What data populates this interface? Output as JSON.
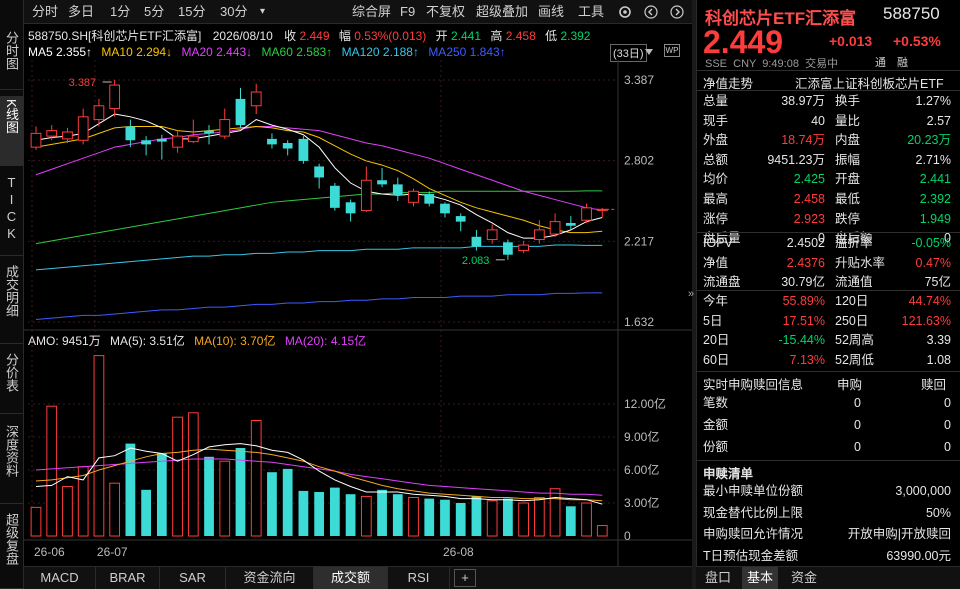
{
  "left_tabs": [
    {
      "label": "分时图",
      "name": "vtab-fenshi"
    },
    {
      "label": "K线图",
      "name": "vtab-kline"
    },
    {
      "label": "TICK",
      "name": "vtab-tick"
    },
    {
      "label": "成交明细",
      "name": "vtab-chengjiao"
    },
    {
      "label": "分价表",
      "name": "vtab-fenjia"
    },
    {
      "label": "深度资料",
      "name": "vtab-shendu"
    },
    {
      "label": "超级复盘",
      "name": "vtab-fupan"
    }
  ],
  "toolbar": {
    "fenshi": "分时",
    "duori": "多日",
    "m1": "1分",
    "m5": "5分",
    "m15": "15分",
    "m30": "30分",
    "more": "▾",
    "zonghe": "综合屏",
    "f9": "F9",
    "bufuquan": "不复权",
    "chaoji": "超级叠加",
    "huaxian": "画线",
    "gongju": "工具"
  },
  "info": {
    "code_name": "588750.SH[科创芯片ETF汇添富]",
    "date": "2026/08/10",
    "close_label": "收",
    "close": "2.449",
    "change_label": "幅",
    "change": "0.53%(0.013)",
    "open_label": "开",
    "open": "2.441",
    "high_label": "高",
    "high": "2.458",
    "low_label": "低",
    "low": "2.392",
    "ma5": "MA5 2.355↑",
    "ma10": "MA10 2.294↓",
    "ma20": "MA20 2.443↓",
    "ma60": "MA60 2.583↑",
    "ma120": "MA120 2.188↑",
    "ma250": "MA250 1.843↑",
    "period_count": "(33日)"
  },
  "price_axis": [
    "3.387",
    "2.802",
    "2.217",
    "1.632"
  ],
  "annotations": {
    "high": "3.387",
    "low": "2.083"
  },
  "volume_info": {
    "amo": "AMO: 9451万",
    "ma5": "MA(5): 3.51亿",
    "ma10": "MA(10): 3.70亿",
    "ma20": "MA(20): 4.15亿"
  },
  "volume_axis": [
    "12.00亿",
    "9.00亿",
    "6.00亿",
    "3.00亿",
    "0"
  ],
  "date_axis": [
    "26-06",
    "26-07",
    "26-08"
  ],
  "bottom_tabs": [
    "MACD",
    "BRAR",
    "SAR",
    "资金流向",
    "成交额",
    "RSI",
    "+"
  ],
  "colors": {
    "up": "#ff3c3c",
    "down": "#00d36a",
    "cyan": "#3ddbd6",
    "ma5": "#ffffff",
    "ma10": "#f5c400",
    "ma20": "#e040fb",
    "ma60": "#2ecc40",
    "ma120": "#37c6e6",
    "ma250": "#3d5cff"
  },
  "chart_data": {
    "type": "candlestick",
    "candles": [
      {
        "o": 2.9,
        "c": 3.0,
        "h": 3.05,
        "l": 2.88
      },
      {
        "o": 2.98,
        "c": 3.02,
        "h": 3.06,
        "l": 2.95
      },
      {
        "o": 2.96,
        "c": 3.01,
        "h": 3.04,
        "l": 2.93
      },
      {
        "o": 2.95,
        "c": 3.12,
        "h": 3.18,
        "l": 2.92
      },
      {
        "o": 3.1,
        "c": 3.2,
        "h": 3.25,
        "l": 3.05
      },
      {
        "o": 3.18,
        "c": 3.35,
        "h": 3.387,
        "l": 3.12
      },
      {
        "o": 3.05,
        "c": 2.95,
        "h": 3.1,
        "l": 2.9
      },
      {
        "o": 2.95,
        "c": 2.92,
        "h": 2.98,
        "l": 2.84
      },
      {
        "o": 2.96,
        "c": 2.94,
        "h": 2.99,
        "l": 2.81
      },
      {
        "o": 2.9,
        "c": 2.98,
        "h": 3.02,
        "l": 2.86
      },
      {
        "o": 2.94,
        "c": 2.98,
        "h": 3.1,
        "l": 2.93
      },
      {
        "o": 3.02,
        "c": 3.0,
        "h": 3.06,
        "l": 2.92
      },
      {
        "o": 2.98,
        "c": 3.1,
        "h": 3.18,
        "l": 2.96
      },
      {
        "o": 3.25,
        "c": 3.06,
        "h": 3.33,
        "l": 3.04
      },
      {
        "o": 3.2,
        "c": 3.3,
        "h": 3.36,
        "l": 3.14
      },
      {
        "o": 2.96,
        "c": 2.92,
        "h": 3.0,
        "l": 2.89
      },
      {
        "o": 2.93,
        "c": 2.89,
        "h": 2.95,
        "l": 2.84
      },
      {
        "o": 2.96,
        "c": 2.8,
        "h": 2.98,
        "l": 2.78
      },
      {
        "o": 2.76,
        "c": 2.68,
        "h": 2.78,
        "l": 2.6
      },
      {
        "o": 2.62,
        "c": 2.46,
        "h": 2.64,
        "l": 2.44
      },
      {
        "o": 2.5,
        "c": 2.42,
        "h": 2.52,
        "l": 2.36
      },
      {
        "o": 2.44,
        "c": 2.66,
        "h": 2.76,
        "l": 2.43
      },
      {
        "o": 2.66,
        "c": 2.63,
        "h": 2.75,
        "l": 2.61
      },
      {
        "o": 2.63,
        "c": 2.55,
        "h": 2.68,
        "l": 2.51
      },
      {
        "o": 2.5,
        "c": 2.58,
        "h": 2.6,
        "l": 2.47
      },
      {
        "o": 2.56,
        "c": 2.49,
        "h": 2.58,
        "l": 2.47
      },
      {
        "o": 2.49,
        "c": 2.42,
        "h": 2.5,
        "l": 2.39
      },
      {
        "o": 2.4,
        "c": 2.36,
        "h": 2.42,
        "l": 2.29
      },
      {
        "o": 2.25,
        "c": 2.18,
        "h": 2.3,
        "l": 2.15
      },
      {
        "o": 2.23,
        "c": 2.3,
        "h": 2.34,
        "l": 2.2
      },
      {
        "o": 2.21,
        "c": 2.12,
        "h": 2.23,
        "l": 2.083
      },
      {
        "o": 2.15,
        "c": 2.19,
        "h": 2.22,
        "l": 2.13
      },
      {
        "o": 2.23,
        "c": 2.3,
        "h": 2.37,
        "l": 2.2
      },
      {
        "o": 2.27,
        "c": 2.36,
        "h": 2.42,
        "l": 2.25
      },
      {
        "o": 2.35,
        "c": 2.33,
        "h": 2.4,
        "l": 2.3
      },
      {
        "o": 2.37,
        "c": 2.46,
        "h": 2.49,
        "l": 2.35
      },
      {
        "o": 2.441,
        "c": 2.449,
        "h": 2.458,
        "l": 2.392
      }
    ],
    "volumes": [
      2.6,
      11.8,
      4.5,
      6.3,
      16.4,
      4.8,
      8.4,
      4.2,
      7.5,
      10.8,
      11.2,
      7.2,
      6.8,
      8.0,
      10.5,
      5.8,
      6.1,
      4.1,
      4.0,
      4.4,
      3.8,
      3.6,
      4.2,
      3.8,
      3.5,
      3.4,
      3.3,
      3.0,
      3.6,
      3.2,
      3.4,
      3.0,
      3.5,
      4.3,
      2.7,
      3.0,
      0.95
    ],
    "vol_ma5": [
      4.5,
      4.6,
      5.4,
      5.1,
      7.1,
      7.3,
      8.0,
      7.7,
      7.5,
      6.8,
      7.4,
      8.1,
      8.3,
      8.4,
      8.2,
      7.8,
      7.6,
      6.9,
      5.9,
      5.1,
      4.5,
      4.0,
      4.0,
      4.0,
      3.8,
      3.7,
      3.6,
      3.4,
      3.4,
      3.3,
      3.3,
      3.2,
      3.3,
      3.5,
      3.4,
      3.3,
      2.9
    ],
    "vol_ma10": [
      5.0,
      5.1,
      5.3,
      5.5,
      6.0,
      6.4,
      6.8,
      7.2,
      7.5,
      7.6,
      7.8,
      7.9,
      7.8,
      7.7,
      7.6,
      7.4,
      7.1,
      6.8,
      6.3,
      5.9,
      5.4,
      5.0,
      4.6,
      4.3,
      4.1,
      3.9,
      3.8,
      3.7,
      3.6,
      3.5,
      3.5,
      3.4,
      3.4,
      3.4,
      3.3,
      3.3,
      3.2
    ],
    "vol_ma20": [
      6.0,
      6.1,
      6.2,
      6.3,
      6.4,
      6.5,
      6.6,
      6.7,
      6.8,
      6.9,
      7.0,
      7.0,
      7.0,
      6.9,
      6.8,
      6.7,
      6.5,
      6.3,
      6.1,
      5.9,
      5.6,
      5.4,
      5.2,
      5.0,
      4.8,
      4.6,
      4.5,
      4.4,
      4.3,
      4.2,
      4.1,
      4.0,
      3.9,
      3.9,
      3.8,
      3.8,
      3.7
    ],
    "ma5": [
      2.95,
      2.97,
      2.98,
      3.0,
      3.07,
      3.14,
      3.12,
      3.09,
      3.04,
      2.96,
      2.96,
      2.98,
      3.0,
      3.02,
      3.1,
      3.06,
      3.03,
      2.99,
      2.9,
      2.75,
      2.64,
      2.58,
      2.56,
      2.55,
      2.56,
      2.55,
      2.52,
      2.48,
      2.41,
      2.35,
      2.28,
      2.24,
      2.24,
      2.26,
      2.3,
      2.36,
      2.39
    ],
    "ma10": [
      2.9,
      2.92,
      2.94,
      2.96,
      3.0,
      3.04,
      3.05,
      3.05,
      3.05,
      3.02,
      3.01,
      3.02,
      3.03,
      3.04,
      3.05,
      3.04,
      3.02,
      3.01,
      2.97,
      2.91,
      2.85,
      2.8,
      2.77,
      2.73,
      2.67,
      2.6,
      2.55,
      2.5,
      2.46,
      2.43,
      2.4,
      2.37,
      2.33,
      2.3,
      2.28,
      2.28,
      2.29
    ],
    "ma20": [
      2.7,
      2.74,
      2.78,
      2.82,
      2.86,
      2.9,
      2.92,
      2.94,
      2.96,
      2.97,
      2.99,
      3.0,
      3.01,
      3.03,
      3.05,
      3.05,
      3.04,
      3.03,
      3.02,
      2.99,
      2.96,
      2.93,
      2.91,
      2.88,
      2.85,
      2.82,
      2.78,
      2.74,
      2.7,
      2.66,
      2.62,
      2.58,
      2.55,
      2.52,
      2.49,
      2.46,
      2.443
    ],
    "ma60": [
      2.2,
      2.22,
      2.24,
      2.26,
      2.28,
      2.3,
      2.32,
      2.34,
      2.36,
      2.38,
      2.4,
      2.42,
      2.44,
      2.46,
      2.48,
      2.5,
      2.51,
      2.52,
      2.53,
      2.54,
      2.55,
      2.56,
      2.56,
      2.57,
      2.57,
      2.57,
      2.58,
      2.58,
      2.58,
      2.58,
      2.58,
      2.58,
      2.58,
      2.58,
      2.58,
      2.583,
      2.583
    ],
    "ma120": [
      2.01,
      2.02,
      2.03,
      2.04,
      2.05,
      2.06,
      2.07,
      2.08,
      2.09,
      2.1,
      2.11,
      2.11,
      2.12,
      2.12,
      2.13,
      2.13,
      2.14,
      2.14,
      2.15,
      2.15,
      2.15,
      2.16,
      2.16,
      2.16,
      2.17,
      2.17,
      2.17,
      2.17,
      2.18,
      2.18,
      2.18,
      2.18,
      2.18,
      2.19,
      2.19,
      2.188,
      2.188
    ],
    "ma250": [
      1.65,
      1.66,
      1.67,
      1.68,
      1.68,
      1.69,
      1.7,
      1.71,
      1.72,
      1.72,
      1.73,
      1.74,
      1.74,
      1.75,
      1.76,
      1.76,
      1.77,
      1.77,
      1.78,
      1.78,
      1.79,
      1.79,
      1.8,
      1.8,
      1.81,
      1.81,
      1.81,
      1.82,
      1.82,
      1.82,
      1.83,
      1.83,
      1.83,
      1.84,
      1.84,
      1.843,
      1.843
    ],
    "ylim": [
      1.632,
      3.387
    ],
    "vol_ylim": [
      0,
      12
    ]
  },
  "right": {
    "title": "科创芯片ETF汇添富",
    "code": "588750",
    "price": "2.449",
    "change": "+0.013",
    "change_pct": "+0.53%",
    "meta": "SSE  CNY  9:49:08  交易中",
    "tong": "通",
    "rong": "融",
    "netval_title": "净值走势",
    "fund_full": "汇添富上证科创板芯片ETF",
    "rows": [
      [
        {
          "t": "总量",
          "c": "white"
        },
        {
          "t": "38.97万",
          "c": "white"
        },
        {
          "t": "换手",
          "c": "white"
        },
        {
          "t": "1.27%",
          "c": "white"
        }
      ],
      [
        {
          "t": "现手",
          "c": "white"
        },
        {
          "t": "40",
          "c": "white"
        },
        {
          "t": "量比",
          "c": "white"
        },
        {
          "t": "2.57",
          "c": "white"
        }
      ],
      [
        {
          "t": "外盘",
          "c": "white"
        },
        {
          "t": "18.74万",
          "c": "up"
        },
        {
          "t": "内盘",
          "c": "white"
        },
        {
          "t": "20.23万",
          "c": "down"
        }
      ],
      [
        {
          "t": "总额",
          "c": "white"
        },
        {
          "t": "9451.23万",
          "c": "white"
        },
        {
          "t": "振幅",
          "c": "white"
        },
        {
          "t": "2.71%",
          "c": "white"
        }
      ],
      [
        {
          "t": "均价",
          "c": "white"
        },
        {
          "t": "2.425",
          "c": "down"
        },
        {
          "t": "开盘",
          "c": "white"
        },
        {
          "t": "2.441",
          "c": "down"
        }
      ],
      [
        {
          "t": "最高",
          "c": "white"
        },
        {
          "t": "2.458",
          "c": "up"
        },
        {
          "t": "最低",
          "c": "white"
        },
        {
          "t": "2.392",
          "c": "down"
        }
      ],
      [
        {
          "t": "涨停",
          "c": "white"
        },
        {
          "t": "2.923",
          "c": "up"
        },
        {
          "t": "跌停",
          "c": "white"
        },
        {
          "t": "1.949",
          "c": "down"
        }
      ],
      [
        {
          "t": "盘后量",
          "c": "white"
        },
        {
          "t": "0",
          "c": "white"
        },
        {
          "t": "盘后额",
          "c": "white"
        },
        {
          "t": "0",
          "c": "white"
        }
      ]
    ],
    "rows2": [
      [
        {
          "t": "IOPV",
          "c": "white"
        },
        {
          "t": "2.4502",
          "c": "white"
        },
        {
          "t": "溢折率",
          "c": "white"
        },
        {
          "t": "-0.05%",
          "c": "down"
        }
      ],
      [
        {
          "t": "净值",
          "c": "white"
        },
        {
          "t": "2.4376",
          "c": "up"
        },
        {
          "t": "升贴水率",
          "c": "white"
        },
        {
          "t": "0.47%",
          "c": "up"
        }
      ],
      [
        {
          "t": "流通盘",
          "c": "white"
        },
        {
          "t": "30.79亿",
          "c": "white"
        },
        {
          "t": "流通值",
          "c": "white"
        },
        {
          "t": "75亿",
          "c": "white"
        }
      ]
    ],
    "rows3": [
      [
        {
          "t": "今年",
          "c": "white"
        },
        {
          "t": "55.89%",
          "c": "up"
        },
        {
          "t": "120日",
          "c": "white"
        },
        {
          "t": "44.74%",
          "c": "up"
        }
      ],
      [
        {
          "t": "5日",
          "c": "white"
        },
        {
          "t": "17.51%",
          "c": "up"
        },
        {
          "t": "250日",
          "c": "white"
        },
        {
          "t": "121.63%",
          "c": "up"
        }
      ],
      [
        {
          "t": "20日",
          "c": "white"
        },
        {
          "t": "-15.44%",
          "c": "down"
        },
        {
          "t": "52周高",
          "c": "white"
        },
        {
          "t": "3.39",
          "c": "white"
        }
      ],
      [
        {
          "t": "60日",
          "c": "white"
        },
        {
          "t": "7.13%",
          "c": "up"
        },
        {
          "t": "52周低",
          "c": "white"
        },
        {
          "t": "1.08",
          "c": "white"
        }
      ]
    ],
    "redeem_title": "实时申购赎回信息",
    "redeem_col1": "申购",
    "redeem_col2": "赎回",
    "redeem_rows": [
      {
        "label": "笔数",
        "a": "0",
        "b": "0"
      },
      {
        "label": "金额",
        "a": "0",
        "b": "0"
      },
      {
        "label": "份额",
        "a": "0",
        "b": "0"
      }
    ],
    "list_title": "申赎清单",
    "list_rows": [
      {
        "label": "最小申赎单位份额",
        "value": "3,000,000"
      },
      {
        "label": "现金替代比例上限",
        "value": "50%"
      },
      {
        "label": "申购赎回允许情况",
        "value": "开放申购|开放赎回"
      },
      {
        "label": "T日预估现金差额",
        "value": "63990.00元"
      }
    ],
    "bottom_tabs": [
      "盘口",
      "基本",
      "资金"
    ]
  }
}
